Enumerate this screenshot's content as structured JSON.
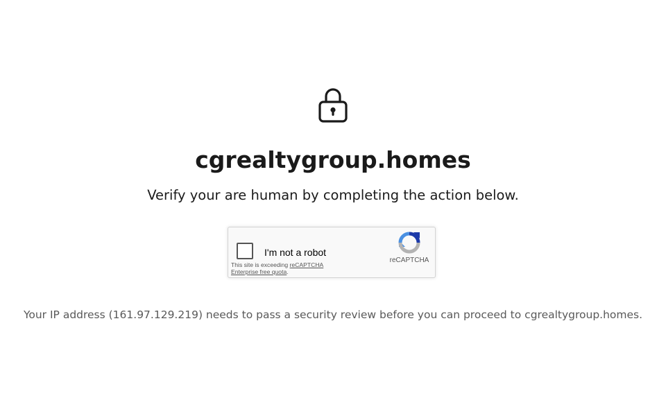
{
  "page": {
    "site_title": "cgrealtygroup.homes",
    "subtitle": "Verify your are human by completing the action below.",
    "ip_notice": "Your IP address (161.97.129.219) needs to pass a security review before you can proceed to cgrealtygroup.homes.",
    "lock_icon": "lock-icon"
  },
  "recaptcha": {
    "checkbox_label": "I'm not a robot",
    "quota_prefix": "This site is exceeding ",
    "quota_link_1": "reCAPTCHA",
    "quota_link_2": "Enterprise free quota",
    "quota_suffix": ".",
    "brand": "reCAPTCHA",
    "logo_icon": "recaptcha-logo-icon",
    "colors": {
      "logo_blue": "#1c3aa9",
      "logo_light_blue": "#4a90e2",
      "logo_gray": "#b3b3b3"
    }
  }
}
